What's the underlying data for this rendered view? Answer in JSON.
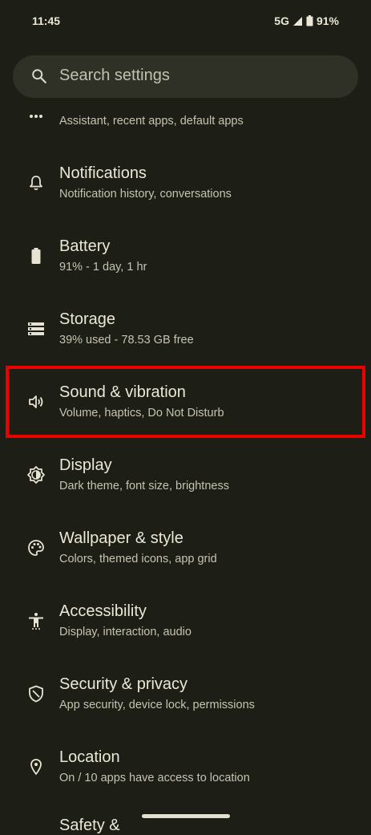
{
  "status_bar": {
    "time": "11:45",
    "network": "5G",
    "battery": "91%"
  },
  "search": {
    "placeholder": "Search settings"
  },
  "settings": [
    {
      "icon": "more-horiz-icon",
      "title": "",
      "subtitle": "Assistant, recent apps, default apps"
    },
    {
      "icon": "bell-icon",
      "title": "Notifications",
      "subtitle": "Notification history, conversations"
    },
    {
      "icon": "battery-icon",
      "title": "Battery",
      "subtitle": "91% - 1 day, 1 hr"
    },
    {
      "icon": "storage-icon",
      "title": "Storage",
      "subtitle": "39% used - 78.53 GB free"
    },
    {
      "icon": "speaker-icon",
      "title": "Sound & vibration",
      "subtitle": "Volume, haptics, Do Not Disturb"
    },
    {
      "icon": "brightness-icon",
      "title": "Display",
      "subtitle": "Dark theme, font size, brightness"
    },
    {
      "icon": "palette-icon",
      "title": "Wallpaper & style",
      "subtitle": "Colors, themed icons, app grid"
    },
    {
      "icon": "accessibility-icon",
      "title": "Accessibility",
      "subtitle": "Display, interaction, audio"
    },
    {
      "icon": "shield-icon",
      "title": "Security & privacy",
      "subtitle": "App security, device lock, permissions"
    },
    {
      "icon": "location-pin-icon",
      "title": "Location",
      "subtitle": "On / 10 apps have access to location"
    },
    {
      "icon": "",
      "title": "Safety &",
      "subtitle": ""
    }
  ],
  "colors": {
    "background": "#1d1e15",
    "search_bg": "#2f3026",
    "highlight": "#ee0000"
  }
}
